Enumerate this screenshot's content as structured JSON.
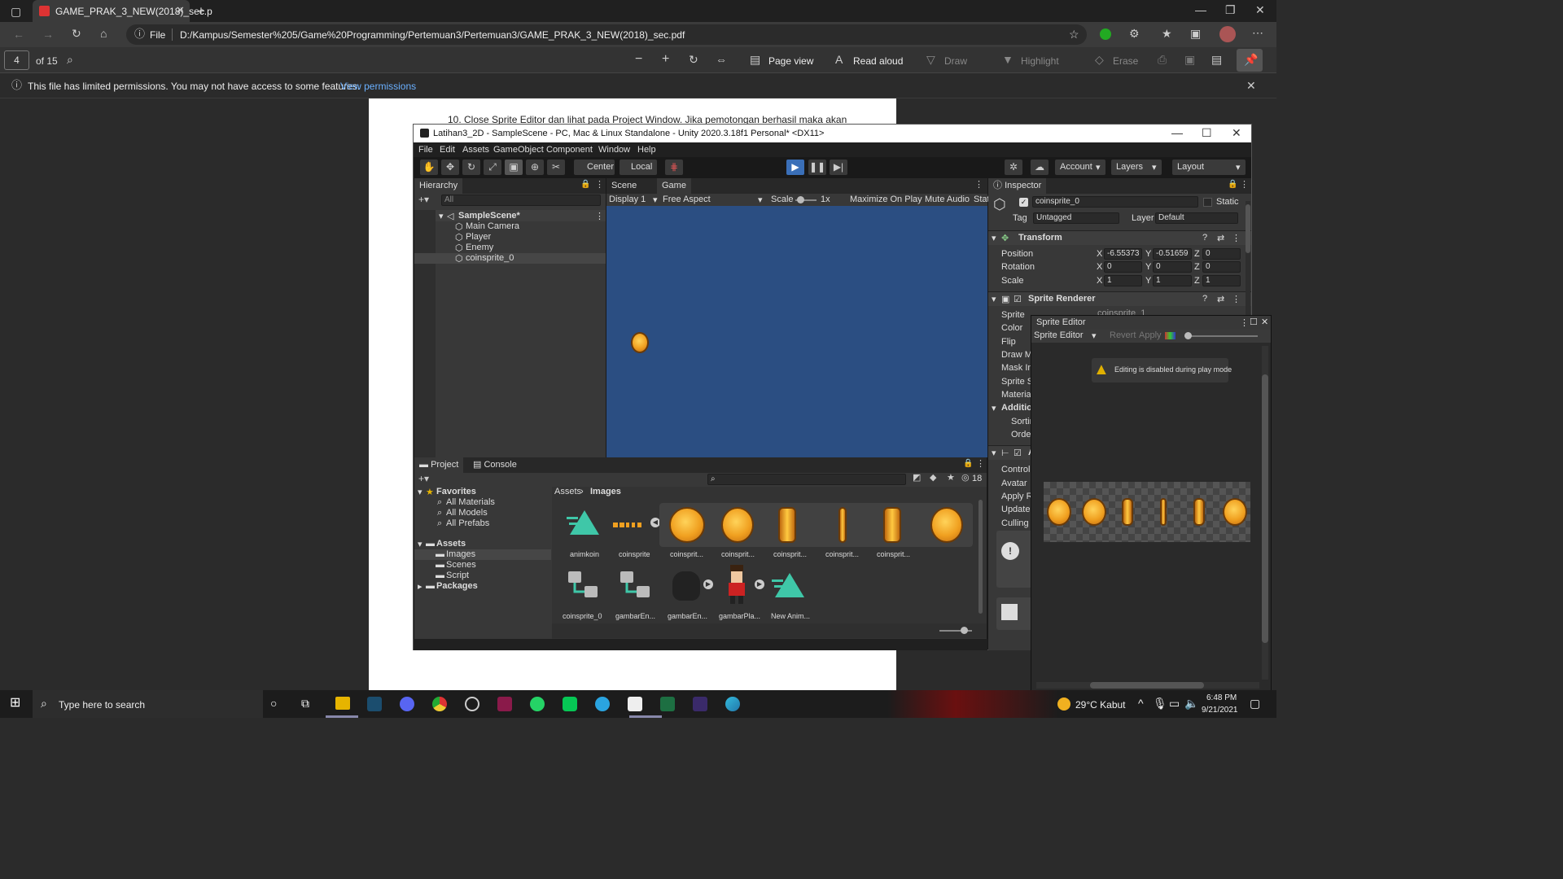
{
  "browser": {
    "tab_title": "GAME_PRAK_3_NEW(2018)_sec.p",
    "address_scheme": "File",
    "address_url": "D:/Kampus/Semester%205/Game%20Programming/Pertemuan3/Pertemuan3/GAME_PRAK_3_NEW(2018)_sec.pdf"
  },
  "pdf_toolbar": {
    "page_number": "4",
    "page_total": "of 15",
    "page_view": "Page view",
    "read_aloud": "Read aloud",
    "draw": "Draw",
    "highlight": "Highlight",
    "erase": "Erase"
  },
  "notice": {
    "text": "This file has limited permissions. You may not have access to some features.",
    "link": "View permissions"
  },
  "document": {
    "line1": "10. Close Sprite Editor dan lihat pada Project Window. Jika pemotongan berhasil maka akan"
  },
  "unity": {
    "title": "Latihan3_2D - SampleScene - PC, Mac & Linux Standalone - Unity 2020.3.18f1 Personal* <DX11>",
    "menu": [
      "File",
      "Edit",
      "Assets",
      "GameObject",
      "Component",
      "Window",
      "Help"
    ],
    "toolbar": {
      "center": "Center",
      "local": "Local",
      "account": "Account",
      "layers": "Layers",
      "layout": "Layout"
    },
    "hierarchy": {
      "tab": "Hierarchy",
      "search_placeholder": "All",
      "scene": "SampleScene*",
      "items": [
        "Main Camera",
        "Player",
        "Enemy",
        "coinsprite_0"
      ]
    },
    "game": {
      "scene_tab": "Scene",
      "game_tab": "Game",
      "display": "Display 1",
      "aspect": "Free Aspect",
      "scale_label": "Scale",
      "scale_value": "1x",
      "maximize": "Maximize On Play",
      "mute": "Mute Audio",
      "stats": "Stat"
    },
    "project": {
      "tab": "Project",
      "console_tab": "Console",
      "hidden_count": "18",
      "favorites": "Favorites",
      "fav_items": [
        "All Materials",
        "All Models",
        "All Prefabs"
      ],
      "assets": "Assets",
      "folders": [
        "Images",
        "Scenes",
        "Script"
      ],
      "packages": "Packages",
      "crumb1": "Assets",
      "crumb2": "Images",
      "row1": [
        "animkoin",
        "coinsprite",
        "coinsprit...",
        "coinsprit...",
        "coinsprit...",
        "coinsprit...",
        "coinsprit..."
      ],
      "row2": [
        "coinsprite_0",
        "gambarEn...",
        "gambarEn...",
        "gambarPla...",
        "New Anim..."
      ]
    },
    "inspector": {
      "tab": "Inspector",
      "name": "coinsprite_0",
      "static": "Static",
      "tag_label": "Tag",
      "tag": "Untagged",
      "layer_label": "Layer",
      "layer": "Default",
      "transform": "Transform",
      "position": "Position",
      "rotation": "Rotation",
      "scale": "Scale",
      "pos": [
        "-6.55373",
        "-0.51659",
        "0"
      ],
      "rot": [
        "0",
        "0",
        "0"
      ],
      "scl": [
        "1",
        "1",
        "1"
      ],
      "sprite_renderer": "Sprite Renderer",
      "sr_rows": [
        "Sprite",
        "Color",
        "Flip",
        "Draw Mo",
        "Mask Int",
        "Sprite So",
        "Material",
        "Addition",
        "Sortin",
        "Order"
      ],
      "sprite_value": "coinsprite_1",
      "anim_rows": [
        "Controlle",
        "Avatar",
        "Apply Ro",
        "Update M",
        "Culling M"
      ]
    },
    "sprite_editor": {
      "title": "Sprite Editor",
      "dropdown": "Sprite Editor",
      "revert": "Revert",
      "apply": "Apply",
      "warning": "Editing is disabled during play mode"
    }
  },
  "taskbar": {
    "search_placeholder": "Type here to search",
    "weather": "29°C  Kabut",
    "time": "6:48 PM",
    "date": "9/21/2021"
  }
}
